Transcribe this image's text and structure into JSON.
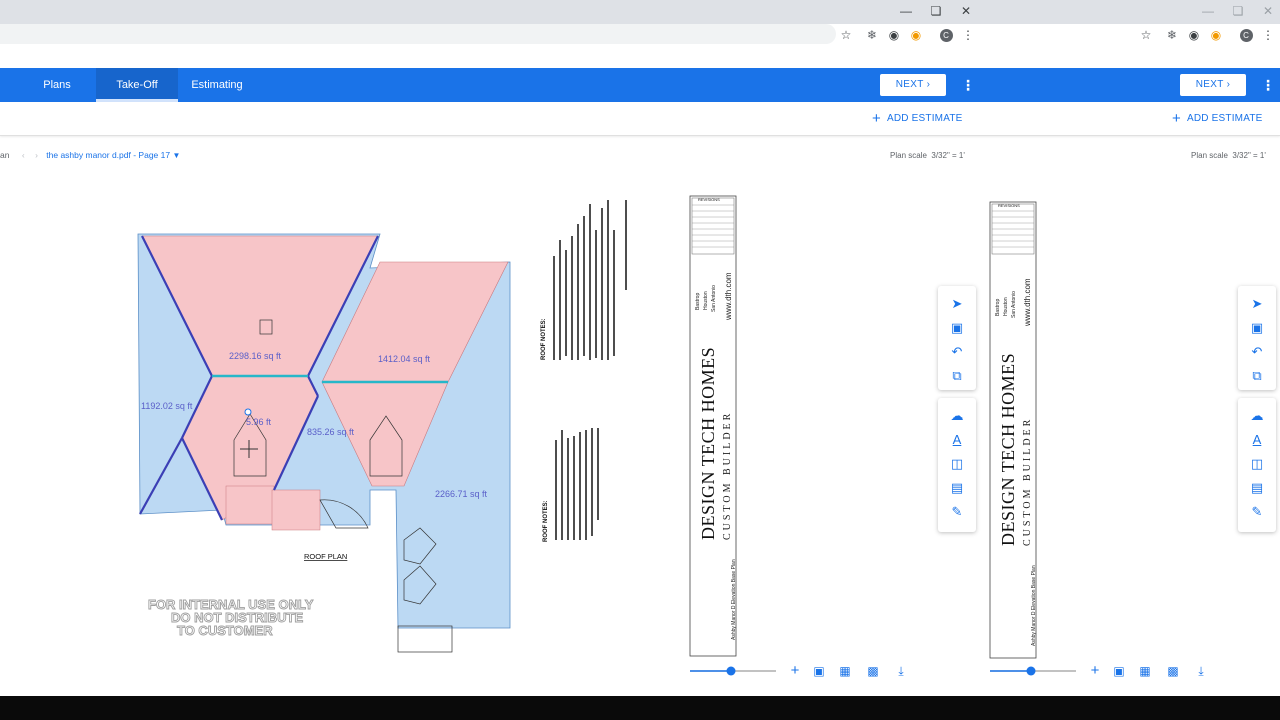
{
  "tabs": [
    {
      "label": "Plans"
    },
    {
      "label": "Take-Off"
    },
    {
      "label": "Estimating"
    }
  ],
  "toolbar": {
    "next_label": "NEXT",
    "add_estimate_label": "ADD ESTIMATE"
  },
  "breadcrumb": {
    "prefix": "an",
    "file": "the ashby manor d.pdf - Page 17"
  },
  "plan_scale": {
    "label": "Plan scale",
    "value": "3/32\" = 1'"
  },
  "areas": [
    {
      "label": "2298.16 sq ft"
    },
    {
      "label": "1412.04 sq ft"
    },
    {
      "label": "1192.02 sq ft"
    },
    {
      "label": "5.96 ft"
    },
    {
      "label": "835.26 sq ft"
    },
    {
      "label": "2266.71 sq ft"
    }
  ],
  "drawing": {
    "roof_plan_title": "ROOF PLAN",
    "roof_notes": "ROOF NOTES:",
    "watermark_1": "FOR INTERNAL USE ONLY",
    "watermark_2": "DO NOT DISTRIBUTE",
    "watermark_3": "TO CUSTOMER",
    "revisions": "REVISIONS",
    "company_1": "DESIGN TECH HOMES",
    "company_2": "CUSTOM BUILDER",
    "website": "www.dth.com",
    "cities": [
      "Bastrop",
      "Houston",
      "San Antonio"
    ],
    "sheet_title": "Ashby Manor D Elevation Base Plan"
  },
  "colors": {
    "accent": "#1a73e8",
    "roof_pink": "#f7c5c8",
    "roof_blue": "#bcd9f3",
    "ridge": "#3b3fb5",
    "hip": "#26b7c9"
  },
  "icons": [
    "select-arrow-icon",
    "select-area-icon",
    "undo-icon",
    "copy-icon",
    "cloud-icon",
    "text-icon",
    "compare-icon",
    "ruler-icon",
    "pencil-icon"
  ]
}
